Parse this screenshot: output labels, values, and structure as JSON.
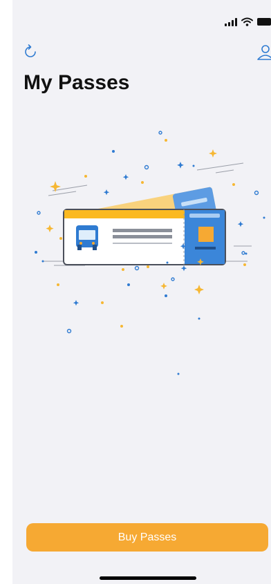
{
  "header": {
    "title": "My Passes",
    "refresh_icon": "refresh-icon",
    "account_icon": "account-icon"
  },
  "status_bar": {
    "icons": [
      "signal-icon",
      "wifi-icon",
      "battery-icon"
    ]
  },
  "main": {
    "illustration_icon": "bus-tickets-illustration"
  },
  "footer": {
    "buy_label": "Buy Passes"
  },
  "colors": {
    "accent": "#f6a933",
    "icon_blue": "#2f7bd1",
    "background": "#f2f2f6"
  }
}
